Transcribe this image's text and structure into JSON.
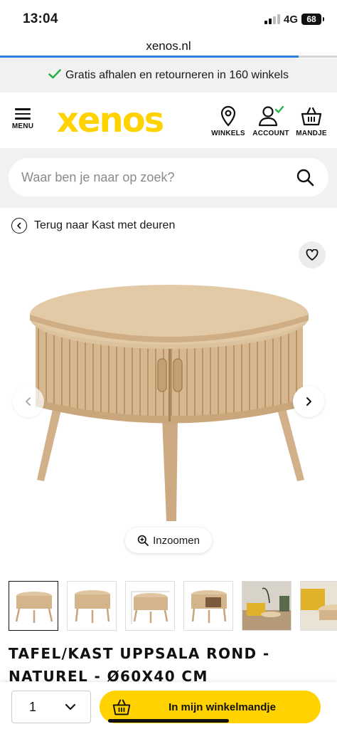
{
  "status": {
    "time": "13:04",
    "network": "4G",
    "battery": "68"
  },
  "browser": {
    "url": "xenos.nl"
  },
  "promo": {
    "text": "Gratis afhalen en retourneren in 160 winkels",
    "icon": "check-icon"
  },
  "header": {
    "menu_label": "MENU",
    "logo": "xenos",
    "winkels_label": "WINKELS",
    "account_label": "ACCOUNT",
    "mandje_label": "MANDJE"
  },
  "search": {
    "placeholder": "Waar ben je naar op zoek?"
  },
  "breadcrumb": {
    "back_label": "Terug naar Kast met deuren"
  },
  "gallery": {
    "zoom_label": "Inzoomen"
  },
  "product": {
    "title": "TAFEL/KAST UPPSALA ROND - NATUREL - Ø60X40 CM"
  },
  "cart": {
    "quantity": "1",
    "add_label": "In mijn winkelmandje"
  },
  "colors": {
    "brand_yellow": "#ffd200",
    "check_green": "#2bb34a",
    "url_progress": "#2f7de1"
  }
}
